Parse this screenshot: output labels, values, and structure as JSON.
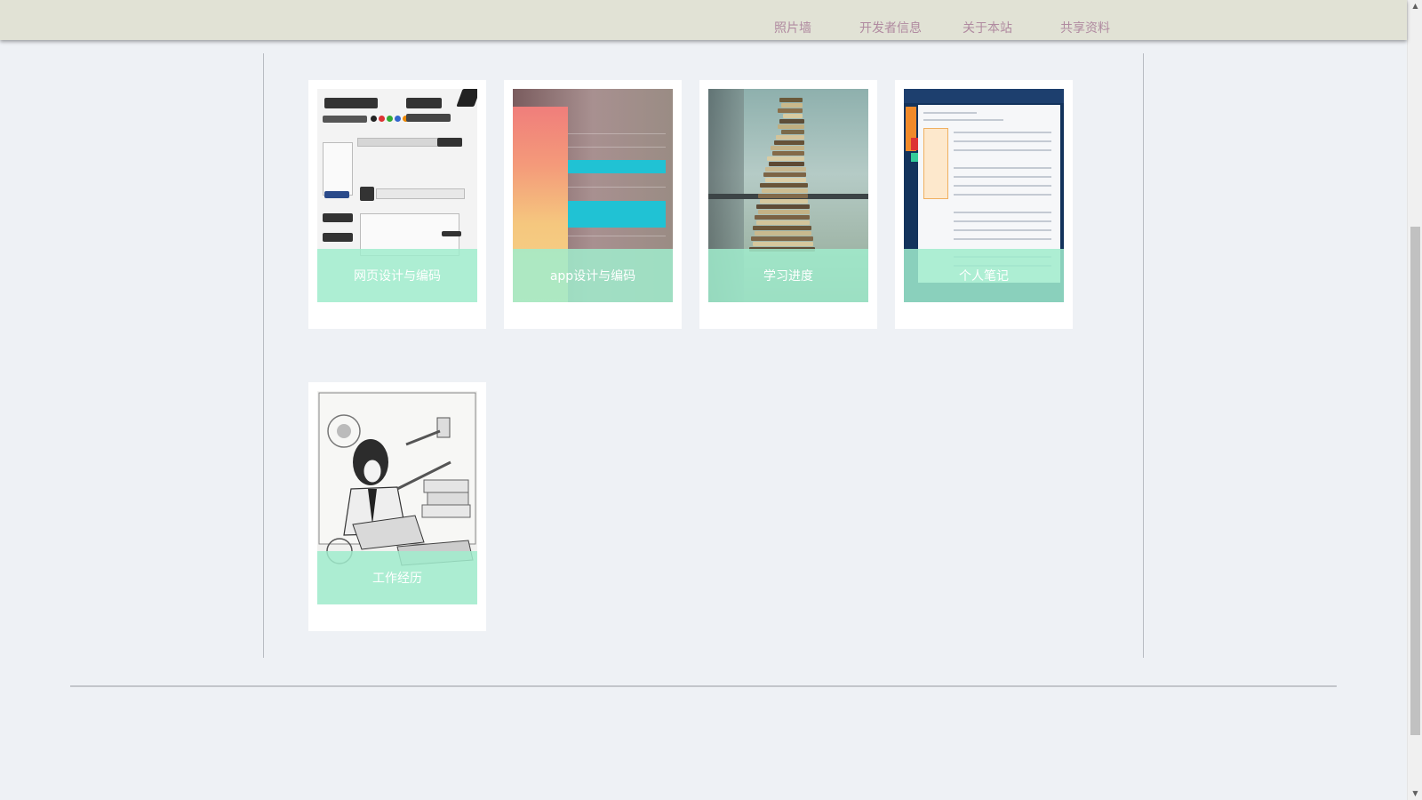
{
  "nav": {
    "items": [
      "照片墙",
      "开发者信息",
      "关于本站",
      "共享资料"
    ]
  },
  "cards": [
    {
      "title": "网页设计与编码"
    },
    {
      "title": "app设计与编码"
    },
    {
      "title": "学习进度"
    },
    {
      "title": "个人笔记"
    },
    {
      "title": "工作经历"
    }
  ],
  "colors": {
    "topbar": "#e1e2d5",
    "nav_text": "#b08aa0",
    "page_bg": "#eef1f5",
    "caption_overlay": "#a0eccd"
  },
  "scrollbar": {
    "up_icon": "triangle-up-icon",
    "down_icon": "triangle-down-icon"
  }
}
